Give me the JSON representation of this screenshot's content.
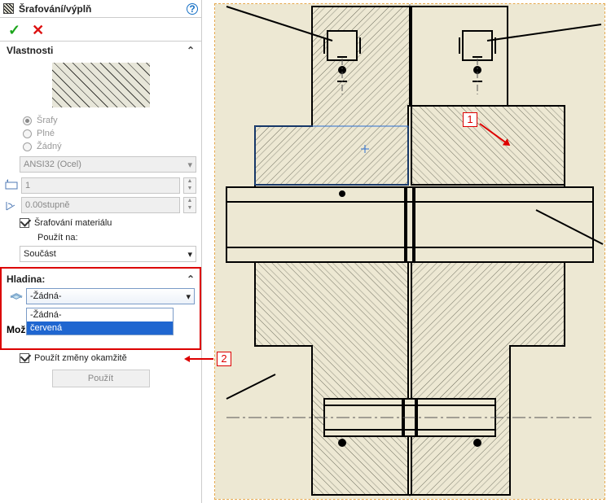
{
  "title": "Šrafování/výplň",
  "ok_tooltip": "OK",
  "cancel_tooltip": "Zrušit",
  "sections": {
    "props": "Vlastnosti",
    "layer": "Hladina:",
    "opts": "Možnosti"
  },
  "radios": {
    "hatch": "Šrafy",
    "solid": "Plné",
    "none": "Žádný"
  },
  "material_select": "ANSI32 (Ocel)",
  "scale_value": "1",
  "angle_value": "0.00stupně",
  "mat_checkbox": "Šrafování materiálu",
  "apply_to": {
    "label": "Použít na:",
    "value": "Součást"
  },
  "layer": {
    "value": "-Žádná-",
    "options": [
      "-Žádná-",
      "červená"
    ]
  },
  "apply_changes": "Použít změny okamžitě",
  "apply_button": "Použít",
  "callouts": {
    "a": "1",
    "b": "2"
  }
}
